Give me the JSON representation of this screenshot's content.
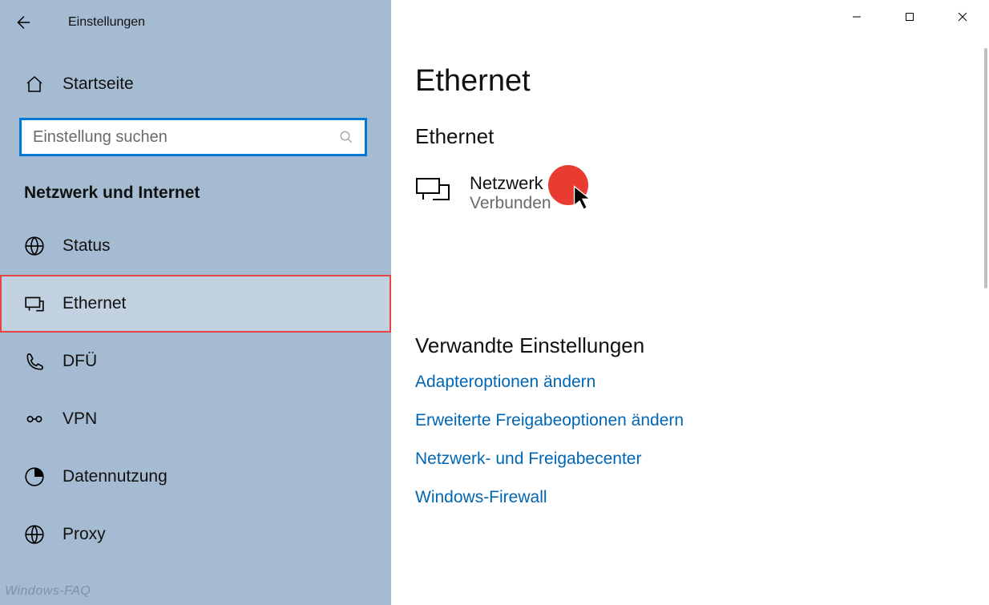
{
  "app_title": "Einstellungen",
  "home_label": "Startseite",
  "search_placeholder": "Einstellung suchen",
  "section_title": "Netzwerk und Internet",
  "nav": {
    "status": "Status",
    "ethernet": "Ethernet",
    "dfu": "DFÜ",
    "vpn": "VPN",
    "datennutzung": "Datennutzung",
    "proxy": "Proxy"
  },
  "page": {
    "title": "Ethernet",
    "subheading": "Ethernet",
    "network": {
      "name": "Netzwerk",
      "status": "Verbunden"
    },
    "related_title": "Verwandte Einstellungen",
    "links": {
      "adapter": "Adapteroptionen ändern",
      "sharing": "Erweiterte Freigabeoptionen ändern",
      "center": "Netzwerk- und Freigabecenter",
      "firewall": "Windows-Firewall"
    }
  },
  "watermark": "Windows-FAQ"
}
